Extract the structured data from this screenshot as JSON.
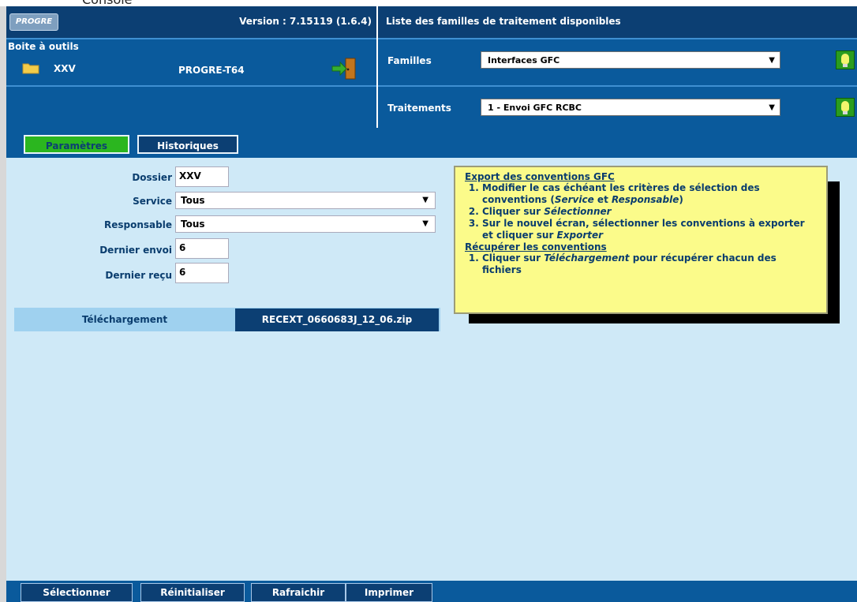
{
  "window_caption_fragment": "Console",
  "header": {
    "logo_text": "PROGRE",
    "version": "Version : 7.15119 (1.6.4)",
    "toolbox_label": "Boite à outils",
    "folder_code": "XXV",
    "server_name": "PROGRE-T64"
  },
  "right_header": {
    "title": "Liste des familles de traitement disponibles",
    "families_label": "Familles",
    "families_value": "Interfaces GFC",
    "treatments_label": "Traitements",
    "treatments_value": "1 - Envoi GFC RCBC"
  },
  "tabs": [
    {
      "label": "Paramètres",
      "active": true
    },
    {
      "label": "Historiques",
      "active": false
    }
  ],
  "form": {
    "dossier_label": "Dossier",
    "dossier_value": "XXV",
    "service_label": "Service",
    "service_value": "Tous",
    "responsable_label": "Responsable",
    "responsable_value": "Tous",
    "dernier_envoi_label": "Dernier envoi",
    "dernier_envoi_value": "6",
    "dernier_recu_label": "Dernier reçu",
    "dernier_recu_value": "6"
  },
  "download": {
    "label": "Téléchargement",
    "file": "RECEXT_0660683J_12_06.zip"
  },
  "help": {
    "section1_title": "Export des conventions GFC",
    "s1_item1_a": "Modifier le cas échéant les critères de sélection des conventions (",
    "s1_item1_service": "Service",
    "s1_item1_b": " et ",
    "s1_item1_responsable": "Responsable",
    "s1_item1_c": ")",
    "s1_item2_a": "Cliquer sur ",
    "s1_item2_sel": "Sélectionner",
    "s1_item3_a": "Sur le nouvel écran, sélectionner les conventions à exporter et cliquer sur ",
    "s1_item3_exp": "Exporter",
    "section2_title": "Récupérer les conventions",
    "s2_item1_a": "Cliquer sur ",
    "s2_item1_tel": "Téléchargement",
    "s2_item1_b": " pour récupérer chacun des fichiers"
  },
  "buttons": {
    "select": "Sélectionner",
    "reset": "Réinitialiser",
    "refresh": "Rafraichir",
    "print": "Imprimer"
  },
  "colors": {
    "header_blue": "#0a5a9c",
    "active_tab_green": "#2bb61f",
    "panel_bg": "#cfe9f7",
    "help_bg": "#fbfb8a"
  }
}
